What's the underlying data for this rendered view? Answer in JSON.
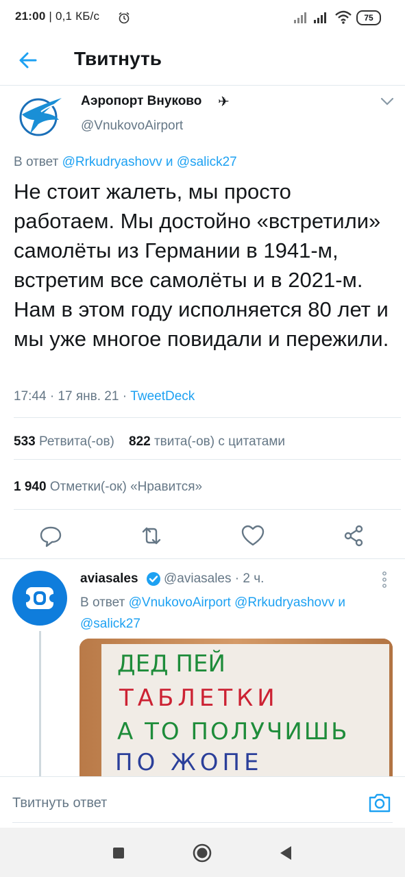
{
  "status_bar": {
    "time": "21:00",
    "speed": " | 0,1 КБ/с",
    "battery": "75"
  },
  "header": {
    "title": "Твитнуть"
  },
  "main_tweet": {
    "author_name": "Аэропорт Внуково",
    "author_badge": "✈",
    "author_handle": "@VnukovoAirport",
    "reply_prefix": "В ответ ",
    "reply_user1": "@Rrkudryashovv",
    "reply_and": " и ",
    "reply_user2": "@salick27",
    "text": "Не стоит жалеть, мы просто работаем. Мы достойно «встретили» самолёты из Германии в 1941-м, встретим все самолёты и в 2021-м. Нам в этом году исполняется 80 лет и мы уже многое повидали и пережили.",
    "time": "17:44 · 17 янв. 21 · ",
    "source": "TweetDeck",
    "retweets_count": "533",
    "retweets_label": " Ретвита(-ов)",
    "quotes_count": "822",
    "quotes_label": " твита(-ов) с цитатами",
    "likes_count": "1 940",
    "likes_label": " Отметки(-ок) «Нравится»"
  },
  "reply_tweet": {
    "author_name": "aviasales",
    "handle_time": "@aviasales · 2 ч.",
    "reply_prefix": "В ответ ",
    "reply_user1": "@VnukovoAirport",
    "reply_user2": "@Rrkudryashovv",
    "reply_and": " и ",
    "reply_user3": "@salick27",
    "photo_lines": [
      "ДЕД ПЕЙ",
      "ТАБЛЕТКИ",
      "А ТО ПОЛУЧИШЬ",
      "ПО ЖОПЕ"
    ]
  },
  "composer": {
    "placeholder": "Твитнуть ответ"
  },
  "colors": {
    "accent": "#1da1f2",
    "muted": "#657786",
    "aviasales_blue": "#0f7ddc"
  },
  "icons": [
    "back-arrow-icon",
    "caret-down-icon",
    "reply-icon",
    "retweet-icon",
    "like-icon",
    "share-icon",
    "verified-icon",
    "more-icon",
    "camera-icon",
    "nav-recents-icon",
    "nav-home-icon",
    "nav-back-icon"
  ]
}
